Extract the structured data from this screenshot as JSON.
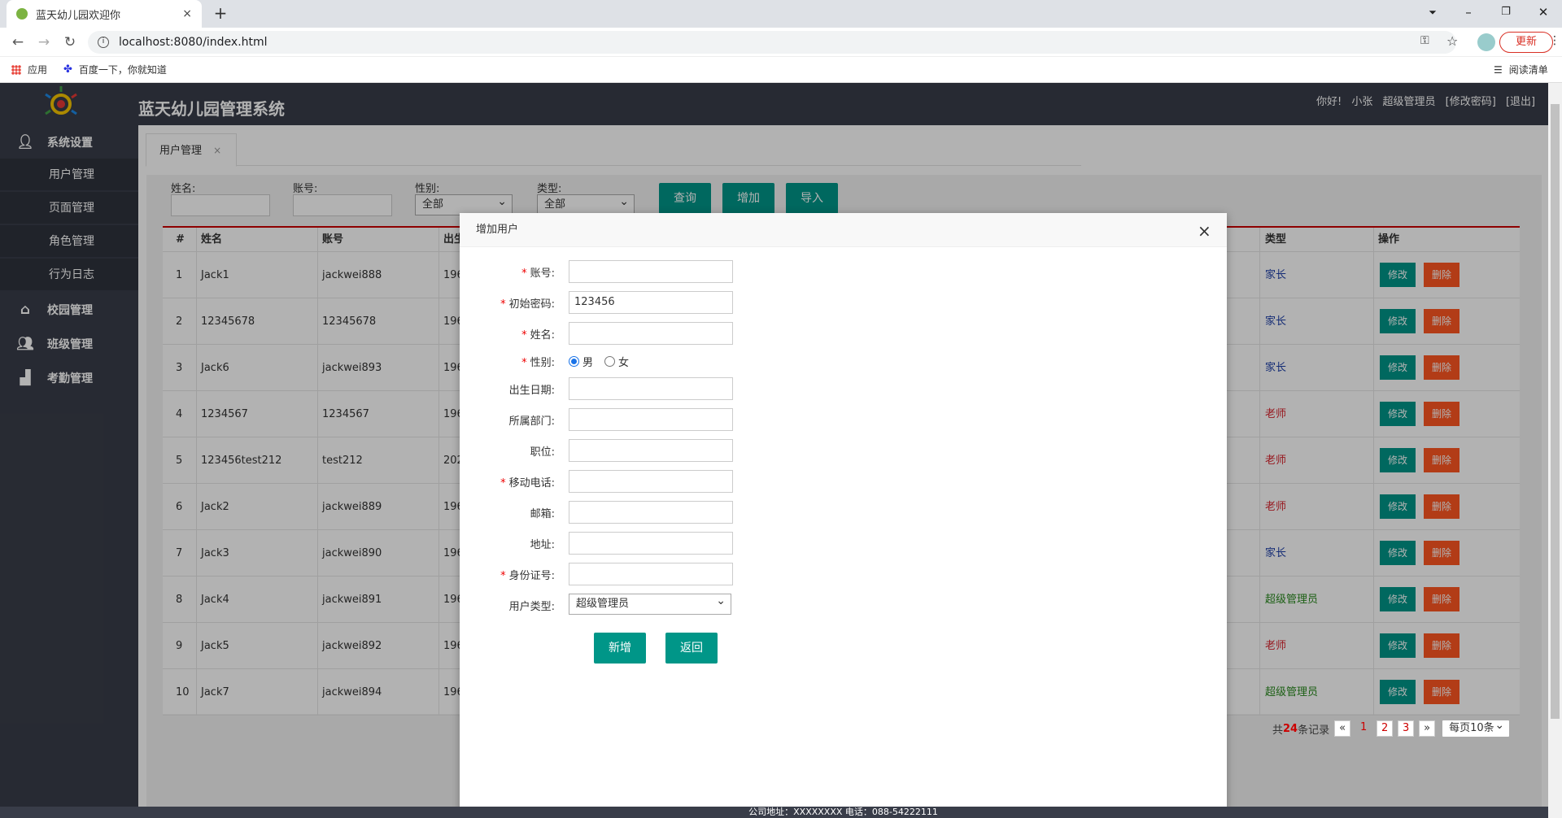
{
  "browser": {
    "tab_title": "蓝天幼儿园欢迎你",
    "tab_close": "×",
    "new_tab": "+",
    "url": "localhost:8080/index.html",
    "update_label": "更新",
    "bookmarks": [
      "应用",
      "百度一下，你就知道"
    ],
    "reading_list": "阅读清单"
  },
  "header": {
    "title": "蓝天幼儿园管理系统",
    "greeting": "你好!",
    "username": "小张",
    "role": "超级管理员",
    "change_password": "[修改密码]",
    "logout": "[退出]"
  },
  "sidebar": {
    "system": "系统设置",
    "subitems": [
      "用户管理",
      "页面管理",
      "角色管理",
      "行为日志"
    ],
    "campus": "校园管理",
    "class": "班级管理",
    "attendance": "考勤管理"
  },
  "page_tab": {
    "label": "用户管理",
    "close": "×"
  },
  "filters": {
    "name_label": "姓名:",
    "account_label": "账号:",
    "gender_label": "性别:",
    "gender_value": "全部",
    "type_label": "类型:",
    "type_value": "全部",
    "query_button": "查询",
    "add_button": "增加",
    "import_button": "导入"
  },
  "table": {
    "headers": {
      "num": "#",
      "name": "姓名",
      "account": "账号",
      "birth": "出生",
      "type": "类型",
      "ops": "操作"
    },
    "edit_label": "修改",
    "delete_label": "删除",
    "rows": [
      {
        "num": "1",
        "name": "Jack1",
        "account": "jackwei888",
        "birth": "196",
        "type": "家长",
        "type_color": "#1e3fa8"
      },
      {
        "num": "2",
        "name": "12345678",
        "account": "12345678",
        "birth": "196",
        "type": "家长",
        "type_color": "#1e3fa8"
      },
      {
        "num": "3",
        "name": "Jack6",
        "account": "jackwei893",
        "birth": "196",
        "type": "家长",
        "type_color": "#1e3fa8"
      },
      {
        "num": "4",
        "name": "1234567",
        "account": "1234567",
        "birth": "196",
        "type": "老师",
        "type_color": "#d9232d"
      },
      {
        "num": "5",
        "name": "123456test212",
        "account": "test212",
        "birth": "202",
        "type": "老师",
        "type_color": "#d9232d"
      },
      {
        "num": "6",
        "name": "Jack2",
        "account": "jackwei889",
        "birth": "196",
        "type": "老师",
        "type_color": "#d9232d"
      },
      {
        "num": "7",
        "name": "Jack3",
        "account": "jackwei890",
        "birth": "196",
        "type": "家长",
        "type_color": "#1e3fa8"
      },
      {
        "num": "8",
        "name": "Jack4",
        "account": "jackwei891",
        "birth": "196",
        "type": "超级管理员",
        "type_color": "#2a8a1f"
      },
      {
        "num": "9",
        "name": "Jack5",
        "account": "jackwei892",
        "birth": "196",
        "type": "老师",
        "type_color": "#d9232d"
      },
      {
        "num": "10",
        "name": "Jack7",
        "account": "jackwei894",
        "birth": "196",
        "type": "超级管理员",
        "type_color": "#2a8a1f"
      }
    ]
  },
  "pager": {
    "total_prefix": "共",
    "total": "24",
    "total_suffix": "条记录",
    "prev": "«",
    "pages": [
      "1",
      "2",
      "3"
    ],
    "next": "»",
    "page_size": "每页10条"
  },
  "modal": {
    "title": "增加用户",
    "close": "×",
    "fields": [
      {
        "label": "账号:",
        "required": true,
        "value": ""
      },
      {
        "label": "初始密码:",
        "required": true,
        "value": "123456"
      },
      {
        "label": "姓名:",
        "required": true,
        "value": ""
      },
      {
        "label": "性别:",
        "required": true,
        "value": ""
      },
      {
        "label": "出生日期:",
        "required": false,
        "value": ""
      },
      {
        "label": "所属部门:",
        "required": false,
        "value": ""
      },
      {
        "label": "职位:",
        "required": false,
        "value": ""
      },
      {
        "label": "移动电话:",
        "required": true,
        "value": ""
      },
      {
        "label": "邮箱:",
        "required": false,
        "value": ""
      },
      {
        "label": "地址:",
        "required": false,
        "value": ""
      },
      {
        "label": "身份证号:",
        "required": true,
        "value": ""
      },
      {
        "label": "用户类型:",
        "required": false,
        "value": "超级管理员"
      }
    ],
    "gender_male": "男",
    "gender_female": "女",
    "required_mark": "*",
    "submit_button": "新增",
    "back_button": "返回"
  },
  "footer": "公司地址：XXXXXXXX 电话：088-54222111"
}
